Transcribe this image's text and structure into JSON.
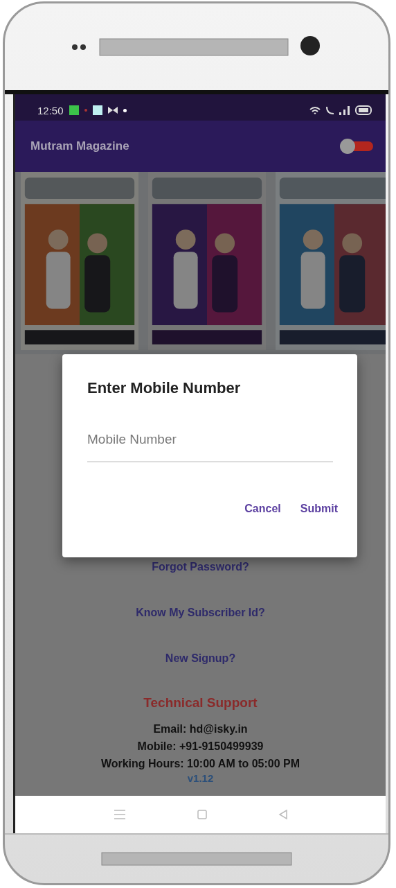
{
  "status_bar": {
    "time": "12:50"
  },
  "app_bar": {
    "title": "Mutram Magazine",
    "toggle": {
      "on": false
    }
  },
  "links": [
    {
      "label": "Forgot Password?"
    },
    {
      "label": "Know My Subscriber Id?"
    },
    {
      "label": "New Signup?"
    }
  ],
  "support": {
    "title": "Technical Support",
    "lines": [
      "Email: hd@isky.in",
      "Mobile: +91-9150499939",
      "Working Hours: 10:00 AM to 05:00 PM"
    ],
    "version": "v1.12"
  },
  "dialog": {
    "title": "Enter Mobile Number",
    "field": {
      "placeholder": "Mobile Number"
    },
    "buttons": [
      "Cancel",
      "Submit"
    ]
  }
}
